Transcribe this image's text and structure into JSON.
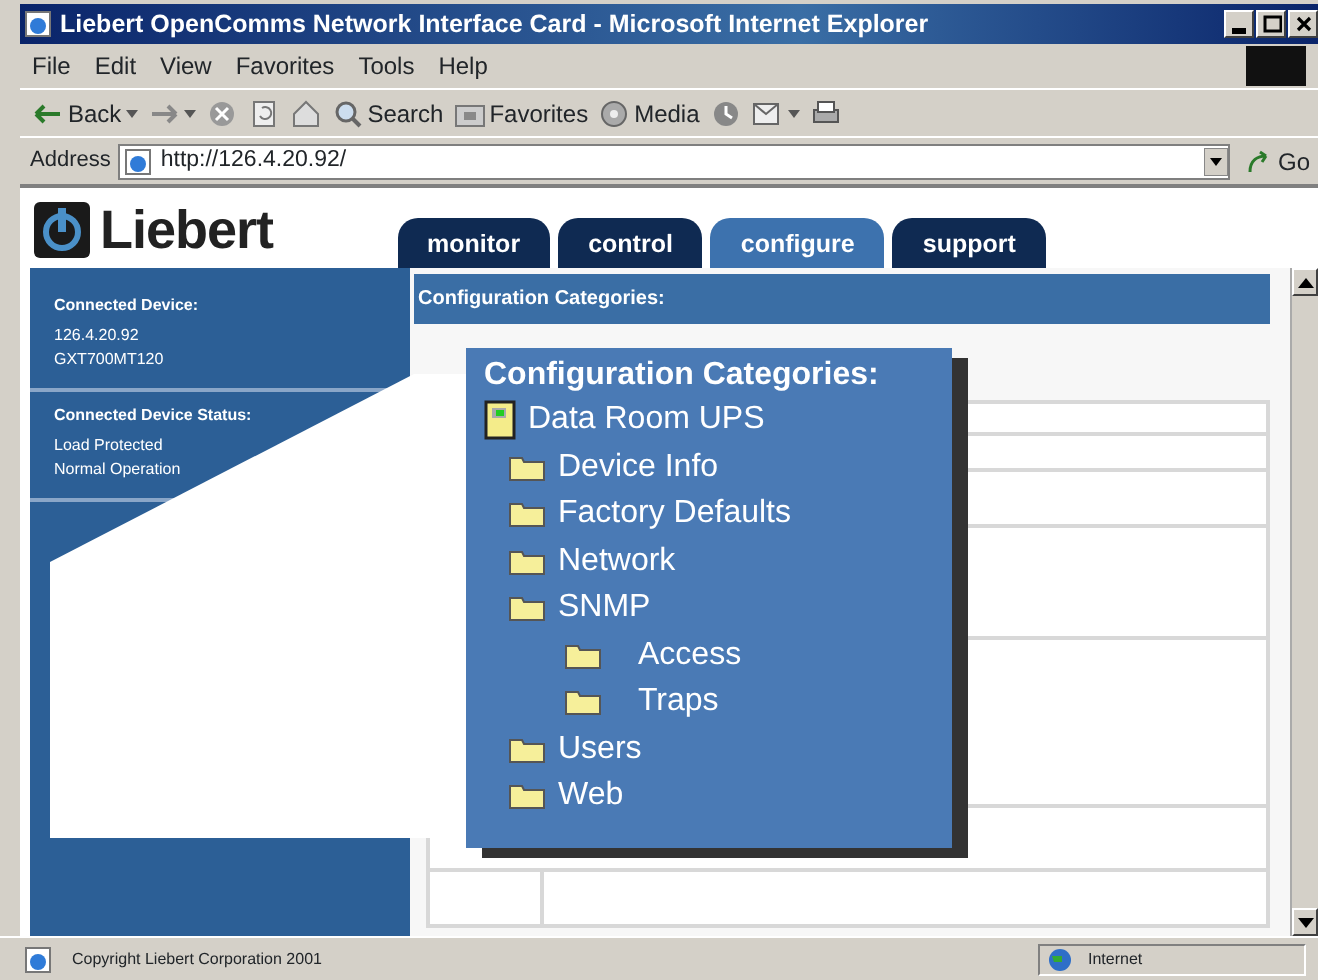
{
  "window": {
    "title": "Liebert OpenComms Network Interface Card - Microsoft Internet Explorer"
  },
  "menu": [
    "File",
    "Edit",
    "View",
    "Favorites",
    "Tools",
    "Help"
  ],
  "toolbar": [
    {
      "kind": "back",
      "label": "Back"
    },
    {
      "kind": "forward"
    },
    {
      "kind": "stop"
    },
    {
      "kind": "refresh"
    },
    {
      "kind": "home"
    },
    {
      "kind": "search",
      "label": "Search"
    },
    {
      "kind": "favorites",
      "label": "Favorites"
    },
    {
      "kind": "media",
      "label": "Media"
    },
    {
      "kind": "history"
    },
    {
      "kind": "mail"
    },
    {
      "kind": "print"
    }
  ],
  "address": {
    "label": "Address",
    "value": "http://126.4.20.92/",
    "go": "Go"
  },
  "page": {
    "logo": "Liebert",
    "tabs": [
      {
        "label": "monitor",
        "selected": false
      },
      {
        "label": "control",
        "selected": false
      },
      {
        "label": "configure",
        "selected": true
      },
      {
        "label": "support",
        "selected": false
      }
    ],
    "sidebar": [
      {
        "heading": "Connected Device:",
        "lines": [
          "126.4.20.92",
          "GXT700MT120"
        ]
      },
      {
        "heading": "Connected Device Status:",
        "lines": [
          "Load Protected",
          "Normal Operation"
        ]
      }
    ],
    "content_header": "Configuration Categories:",
    "callout": {
      "title": "Configuration Categories:",
      "tree": [
        {
          "label": "Data Room UPS",
          "kind": "device",
          "children": [
            {
              "label": "Device Info",
              "kind": "folder"
            },
            {
              "label": "Factory Defaults",
              "kind": "folder"
            },
            {
              "label": "Network",
              "kind": "folder"
            },
            {
              "label": "SNMP",
              "kind": "folder",
              "children": [
                {
                  "label": "Access",
                  "kind": "folder"
                },
                {
                  "label": "Traps",
                  "kind": "folder"
                }
              ]
            },
            {
              "label": "Users",
              "kind": "folder"
            },
            {
              "label": "Web",
              "kind": "folder"
            }
          ]
        }
      ]
    }
  },
  "status_bar": {
    "text": "Copyright Liebert Corporation 2001",
    "zone": "Internet"
  }
}
